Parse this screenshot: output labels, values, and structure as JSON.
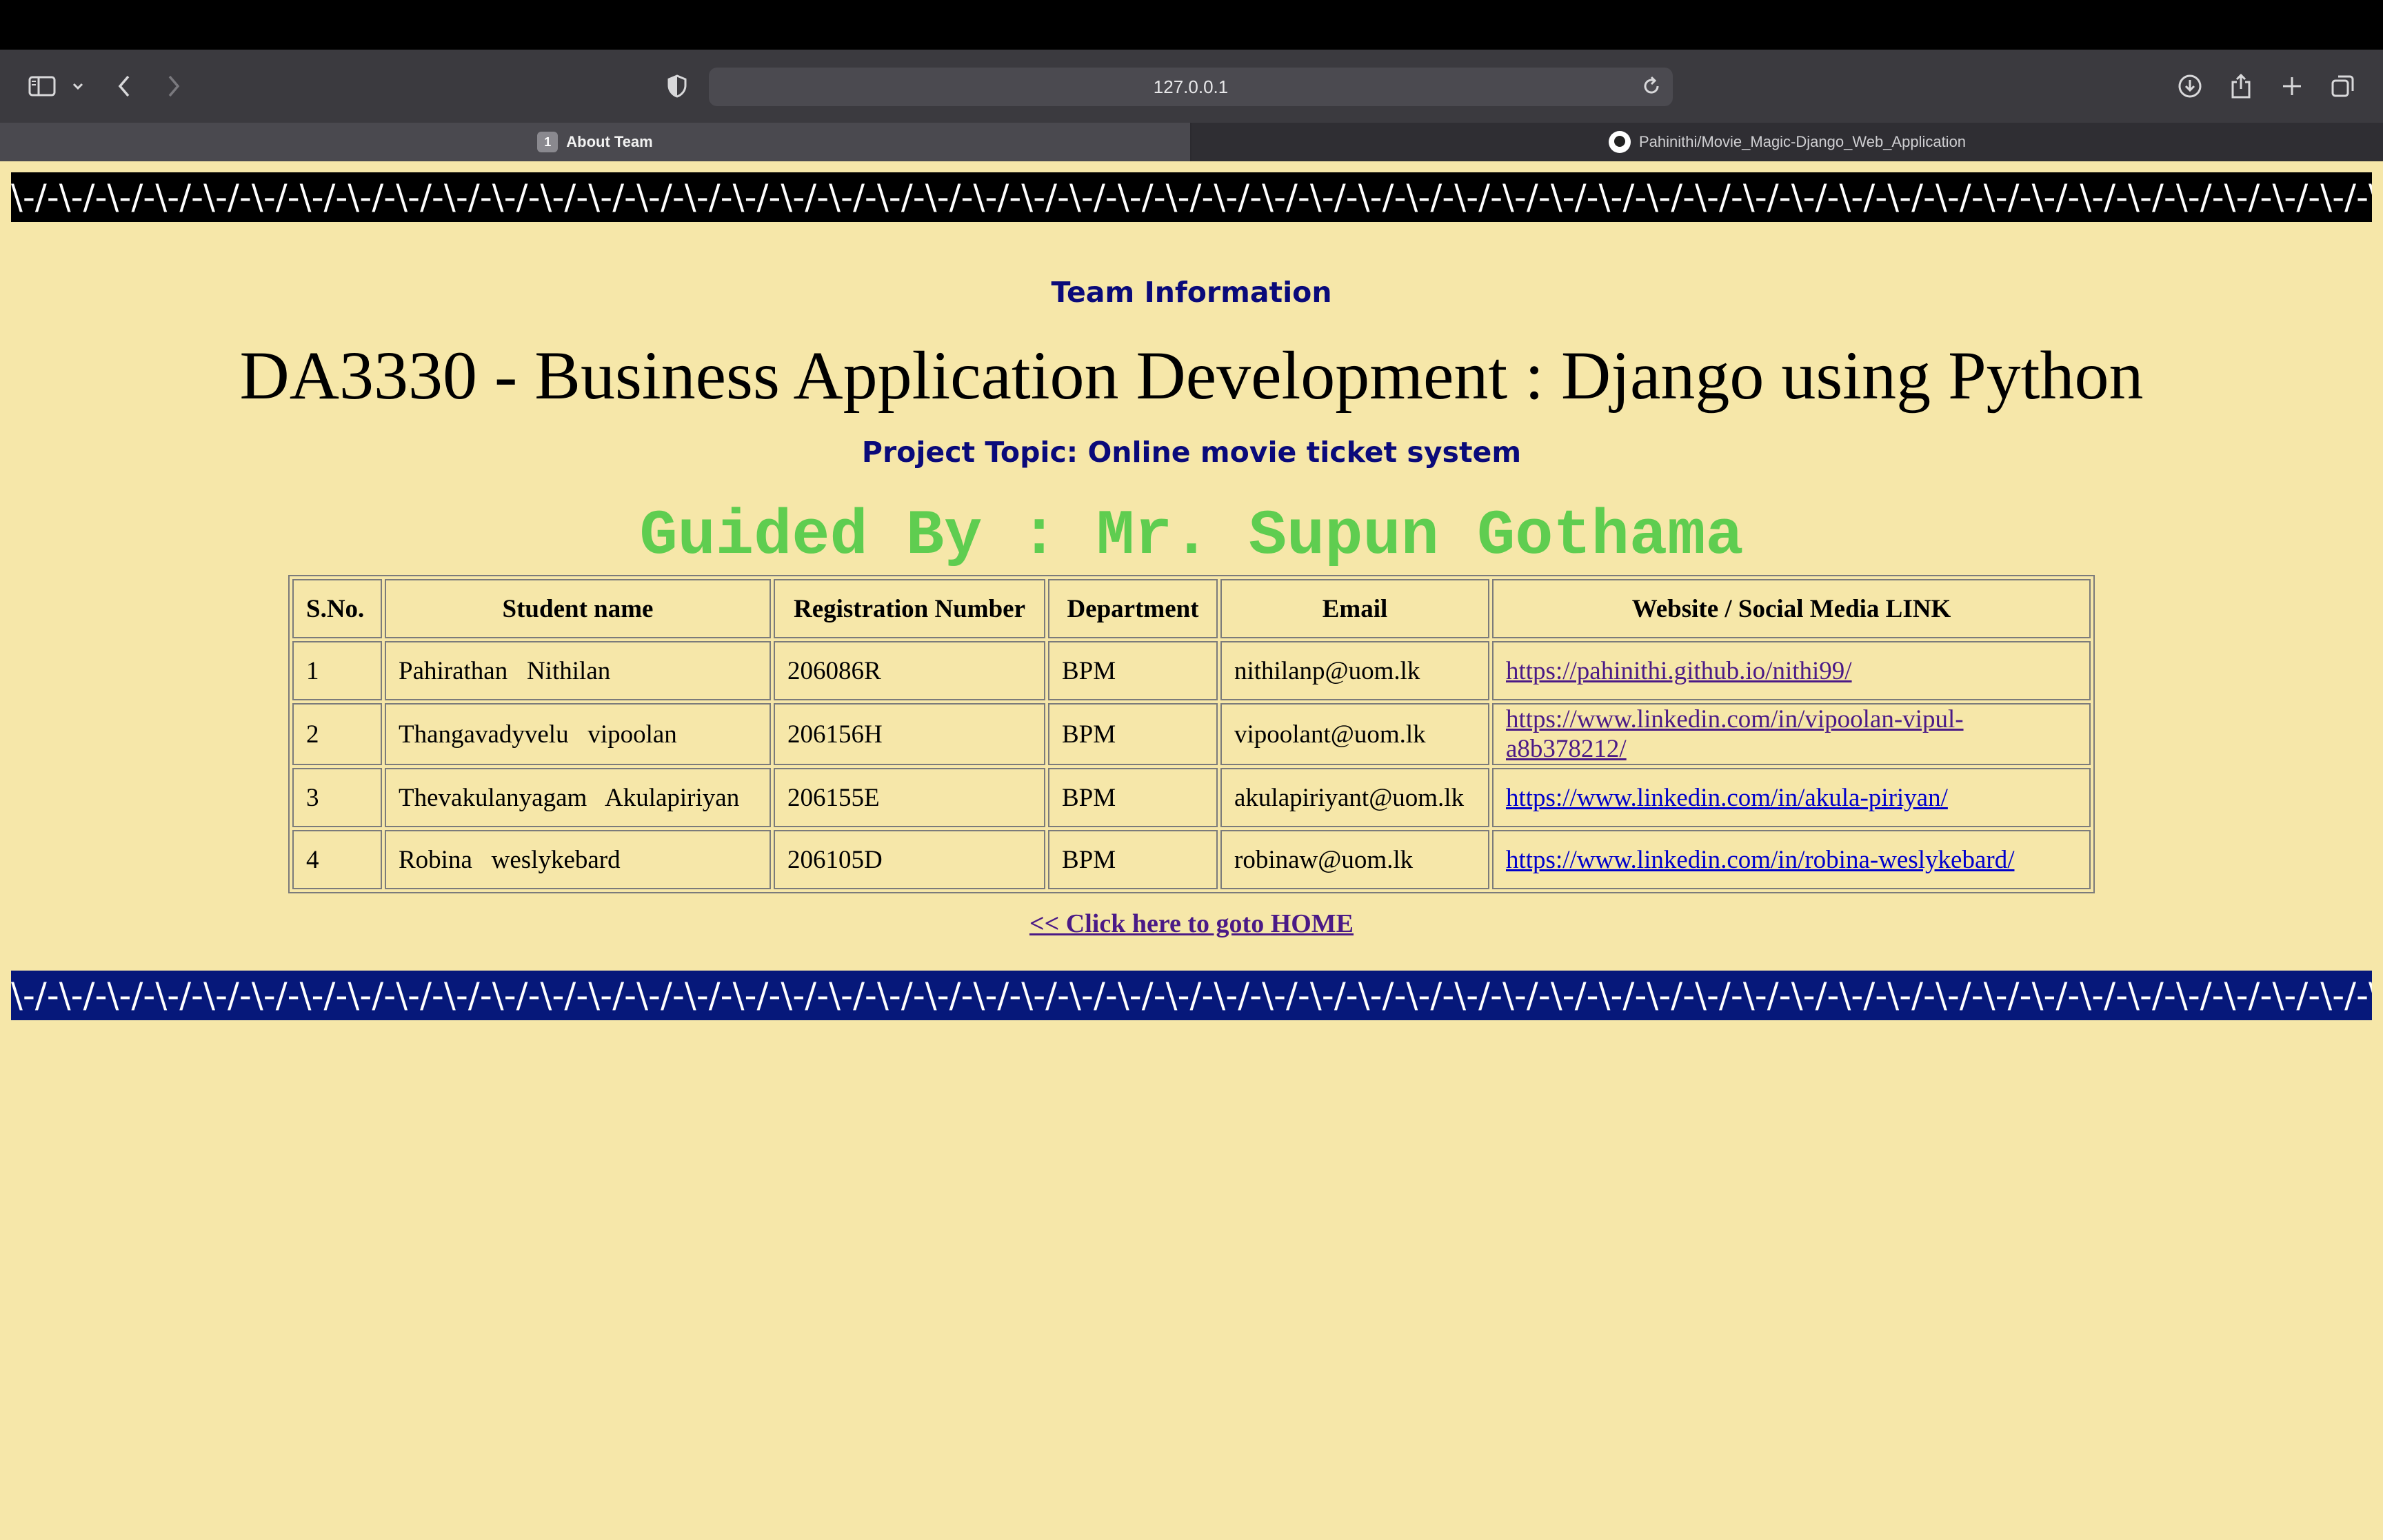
{
  "browser": {
    "url": "127.0.0.1",
    "tabs": [
      {
        "number": "1",
        "title": "About Team"
      },
      {
        "title": "Pahinithi/Movie_Magic-Django_Web_Application"
      }
    ]
  },
  "page": {
    "stripe_top": "\\-/-\\-/-\\-/-\\-/-\\-/-\\-/-\\-/-\\-/-\\-/-\\-/-\\-/-\\-/-\\-/-\\-/-\\-/-\\-/-\\-/-\\-/-\\-/-\\-/-\\-/-\\-/-\\-/-\\-/-\\-/-\\-/-\\-/-\\-/-\\-/-\\-/-\\-/-\\-/-\\-/-\\-/-\\-/-\\-/-\\-/-\\-/-\\-/-\\-/-\\-/-\\-/-\\-/-\\-/-\\-/-\\-/-\\-/-\\-/-\\-/-\\-/-\\-/-\\-/-",
    "stripe_bottom": "\\-/-\\-/-\\-/-\\-/-\\-/-\\-/-\\-/-\\-/-\\-/-\\-/-\\-/-\\-/-\\-/-\\-/-\\-/-\\-/-\\-/-\\-/-\\-/-\\-/-\\-/-\\-/-\\-/-\\-/-\\-/-\\-/-\\-/-\\-/-\\-/-\\-/-\\-/-\\-/-\\-/-\\-/-\\-/-\\-/-\\-/-\\-/-\\-/-\\-/-\\-/-\\-/-\\-/-\\-/-\\-/-\\-/-\\-/-\\-/-\\-/-\\-/-\\-/-\\-/-\\-/-",
    "heading": "Team Information",
    "course": "DA3330 - Business Application Development : Django using Python",
    "topic": "Project Topic: Online movie ticket system",
    "guided_by": "Guided By : Mr. Supun Gothama",
    "table": {
      "headers": [
        "S.No.",
        "Student name",
        "Registration Number",
        "Department",
        "Email",
        "Website / Social Media LINK"
      ],
      "rows": [
        {
          "sno": "1",
          "name": "Pahirathan   Nithilan",
          "reg": "206086R",
          "dept": "BPM",
          "email": "nithilanp@uom.lk",
          "link": "https://pahinithi.github.io/nithi99/"
        },
        {
          "sno": "2",
          "name": "Thangavadyvelu   vipoolan",
          "reg": "206156H",
          "dept": "BPM",
          "email": "vipoolant@uom.lk",
          "link": "https://www.linkedin.com/in/vipoolan-vipul-a8b378212/"
        },
        {
          "sno": "3",
          "name": "Thevakulanyagam   Akulapiriyan",
          "reg": "206155E",
          "dept": "BPM",
          "email": "akulapiriyant@uom.lk",
          "link": "https://www.linkedin.com/in/akula-piriyan/"
        },
        {
          "sno": "4",
          "name": "Robina   weslykebard",
          "reg": "206105D",
          "dept": "BPM",
          "email": "robinaw@uom.lk",
          "link": "https://www.linkedin.com/in/robina-weslykebard/"
        }
      ]
    },
    "home_link": "<< Click here to goto HOME"
  },
  "colors": {
    "background": "#f6e7a9",
    "heading": "#0a0a7a",
    "guided": "#5fcd50",
    "bottom_stripe": "#06187a"
  },
  "icons": [
    "sidebar-icon",
    "chevron-down-icon",
    "back-icon",
    "forward-icon",
    "shield-icon",
    "reload-icon",
    "download-icon",
    "share-icon",
    "plus-icon",
    "tabs-overview-icon",
    "github-icon"
  ]
}
